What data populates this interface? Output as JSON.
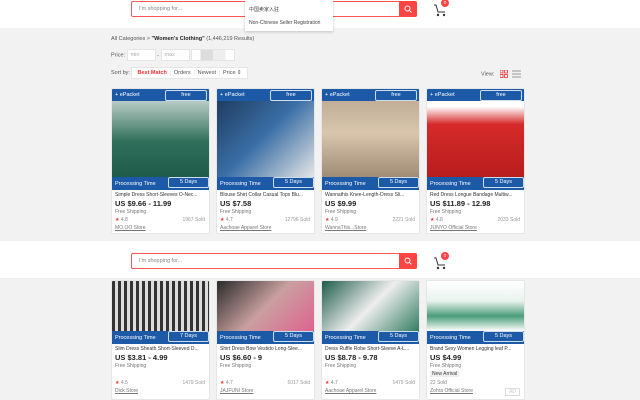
{
  "search": {
    "placeholder": "I'm shopping for...",
    "cart_count": "0"
  },
  "dropdown": [
    "中国卖家入驻",
    "Non-Chinese Seller Registration"
  ],
  "breadcrumb": {
    "root": "All Categories",
    "sep": ">",
    "category": "\"Women's Clothing\"",
    "results": "(1,446,219 Results)"
  },
  "price": {
    "label": "Price:",
    "min": "min",
    "sep": "-",
    "max": "max"
  },
  "sort": {
    "label": "Sort by:",
    "options": [
      "Best Match",
      "Orders",
      "Newest",
      "Price ⇕"
    ]
  },
  "view": {
    "label": "View:"
  },
  "labels": {
    "epacket": "+ ePacket",
    "free": "free",
    "processing": "Processing Time"
  },
  "products_top": [
    {
      "days": "5 Days",
      "title": "Simple Dress Short-Sleeves O-Nec...",
      "price": "US $9.66 - 11.99",
      "ship": "Free Shipping",
      "rating": "4.8",
      "sold": "1967 Sold",
      "store": "MO.OO Store"
    },
    {
      "days": "5 Days",
      "title": "Blouse Shirt Collar Casual Tops Blu...",
      "price": "US $7.58",
      "ship": "Free Shipping",
      "rating": "4.7",
      "sold": "12796 Sold",
      "store": "Aachoae Apparel Store"
    },
    {
      "days": "5 Days",
      "title": "Wannathis Knee-Length-Dress Sli...",
      "price": "US $9.99",
      "ship": "Free Shipping",
      "rating": "4.9",
      "sold": "2221 Sold",
      "store": "WannaThis...Store"
    },
    {
      "days": "5 Days",
      "title": "Red Dress Longue Bandage Multiw...",
      "price": "US $11.89 - 12.98",
      "ship": "Free Shipping",
      "rating": "4.8",
      "sold": "2033 Sold",
      "store": "JUNYO Official Store"
    }
  ],
  "products_bottom": [
    {
      "days": "7 Days",
      "title": "Slim Dress Sheath Short-Sleeved D...",
      "price": "US $3.81 - 4.99",
      "ship": "Free Shipping",
      "rating": "4.5",
      "sold": "1479 Sold",
      "store": "Dick Store"
    },
    {
      "days": "5 Days",
      "title": "Shirt Dress Bow Vestido Long-Slee...",
      "price": "US $6.60 - 9",
      "ship": "Free Shipping",
      "rating": "4.7",
      "sold": "5017 Sold",
      "store": "JAJFUNI Store"
    },
    {
      "days": "5 Days",
      "title": "Dress Ruffle Robe Short-Sleeve A-L...",
      "price": "US $8.78 - 9.78",
      "ship": "Free Shipping",
      "rating": "4.7",
      "sold": "1479 Sold",
      "store": "Aachoae Apparel Store"
    },
    {
      "days": "5 Days",
      "title": "Brand Sexy Women Legging leaf P...",
      "price": "US $4.99",
      "ship": "Free Shipping",
      "badge": "New Arrival",
      "sold": "22 Sold",
      "store": "Zohra Official Store",
      "ad": "AD"
    }
  ]
}
